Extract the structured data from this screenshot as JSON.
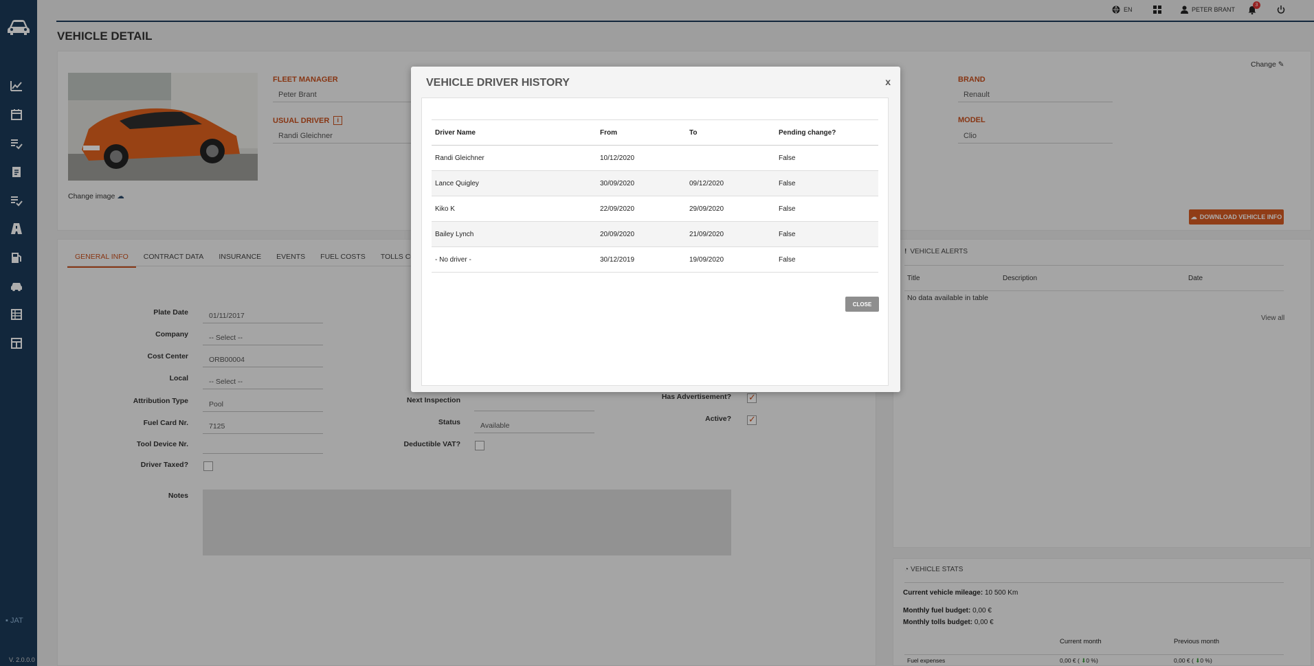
{
  "sidebar": {
    "brand": "JAT",
    "version": "V. 2.0.0.0",
    "items": [
      "chart-icon",
      "calendar-icon",
      "checklist-icon",
      "clipboard-icon",
      "checklist-icon",
      "road-icon",
      "fuel-icon",
      "car-icon",
      "table-icon",
      "layout-icon"
    ]
  },
  "topbar": {
    "language": "EN",
    "user": "PETER BRANT",
    "notifications": "3"
  },
  "page_title": "VEHICLE DETAIL",
  "vehicle": {
    "change_label": "Change",
    "change_image": "Change image",
    "fleet_manager_label": "FLEET MANAGER",
    "fleet_manager": "Peter Brant",
    "usual_driver_label": "USUAL DRIVER",
    "usual_driver": "Randi Gleichner",
    "brand_label": "BRAND",
    "brand": "Renault",
    "model_label": "MODEL",
    "model": "Clio",
    "download": "DOWNLOAD VEHICLE INFO"
  },
  "tabs": [
    "GENERAL INFO",
    "CONTRACT DATA",
    "INSURANCE",
    "EVENTS",
    "FUEL COSTS",
    "TOLLS COSTS"
  ],
  "form": {
    "plate_date_label": "Plate Date",
    "plate_date": "01/11/2017",
    "company_label": "Company",
    "company": "-- Select --",
    "cost_center_label": "Cost Center",
    "cost_center": "ORB00004",
    "local_label": "Local",
    "local": "-- Select --",
    "attribution_type_label": "Attribution Type",
    "attribution_type": "Pool",
    "fuel_card_label": "Fuel Card Nr.",
    "fuel_card": "7125",
    "tool_device_label": "Tool Device Nr.",
    "tool_device": "",
    "driver_taxed_label": "Driver Taxed?",
    "next_inspection_label": "Next Inspection",
    "status_label": "Status",
    "status": "Available",
    "deductible_vat_label": "Deductible VAT?",
    "has_advertisement_label": "Has Advertisement?",
    "active_label": "Active?",
    "notes_label": "Notes"
  },
  "alerts": {
    "title": "VEHICLE ALERTS",
    "columns": [
      "Title",
      "Description",
      "Date"
    ],
    "empty": "No data available in table",
    "view_all": "View all"
  },
  "stats": {
    "title": "VEHICLE STATS",
    "mileage_label": "Current vehicle mileage:",
    "mileage": "10 500 Km",
    "fuel_budget_label": "Monthly fuel budget:",
    "fuel_budget": "0,00 €",
    "tolls_budget_label": "Monthly tolls budget:",
    "tolls_budget": "0,00 €",
    "current_month": "Current month",
    "previous_month": "Previous month",
    "fuel_expenses_label": "Fuel expenses",
    "fuel_current": "0,00 € ( ",
    "fuel_current_pct": "0 %)",
    "fuel_previous": "0,00 € ( ",
    "fuel_previous_pct": "0 %)"
  },
  "modal": {
    "title": "VEHICLE DRIVER HISTORY",
    "x": "x",
    "close": "CLOSE",
    "columns": [
      "Driver Name",
      "From",
      "To",
      "Pending change?"
    ],
    "rows": [
      [
        "Randi Gleichner",
        "10/12/2020",
        "",
        "False"
      ],
      [
        "Lance Quigley",
        "30/09/2020",
        "09/12/2020",
        "False"
      ],
      [
        "Kiko K",
        "22/09/2020",
        "29/09/2020",
        "False"
      ],
      [
        "Bailey Lynch",
        "20/09/2020",
        "21/09/2020",
        "False"
      ],
      [
        "- No driver -",
        "30/12/2019",
        "19/09/2020",
        "False"
      ]
    ]
  },
  "colors": {
    "sidebar": "#1b3a59",
    "accent": "#c8501e",
    "button": "#d55a22"
  }
}
